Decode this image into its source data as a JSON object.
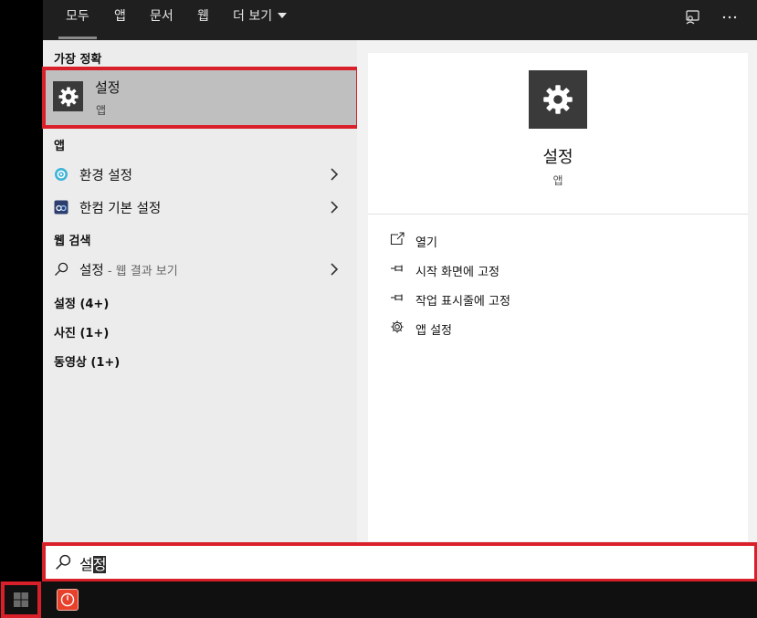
{
  "tabs": [
    {
      "label": "모두"
    },
    {
      "label": "앱"
    },
    {
      "label": "문서"
    },
    {
      "label": "웹"
    },
    {
      "label": "더 보기"
    }
  ],
  "top_icons": [
    "feedback-icon",
    "more-icon"
  ],
  "left": {
    "best_match_header": "가장 정확",
    "best_match": {
      "title": "설정",
      "subtitle": "앱",
      "icon": "gear-icon"
    },
    "apps_header": "앱",
    "apps": [
      {
        "label": "환경 설정",
        "icon": "control-panel-icon"
      },
      {
        "label": "한컴 기본 설정",
        "icon": "hancom-settings-icon"
      }
    ],
    "web_header": "웹 검색",
    "web_result": {
      "label": "설정",
      "hint": " - 웹 결과 보기",
      "icon": "search-icon"
    },
    "groups": [
      {
        "label": "설정 (4+)"
      },
      {
        "label": "사진 (1+)"
      },
      {
        "label": "동영상 (1+)"
      }
    ]
  },
  "preview": {
    "title": "설정",
    "type": "앱",
    "actions": [
      {
        "label": "열기",
        "icon": "open-icon"
      },
      {
        "label": "시작 화면에 고정",
        "icon": "pin-icon"
      },
      {
        "label": "작업 표시줄에 고정",
        "icon": "pin-icon"
      },
      {
        "label": "앱 설정",
        "icon": "gear-icon"
      }
    ]
  },
  "search": {
    "typed_plain": "설",
    "typed_selected": "정"
  },
  "colors": {
    "highlight_red": "#d9202a",
    "tile_dark": "#3a3a3a",
    "best_match_bg": "#bfbfbf"
  }
}
